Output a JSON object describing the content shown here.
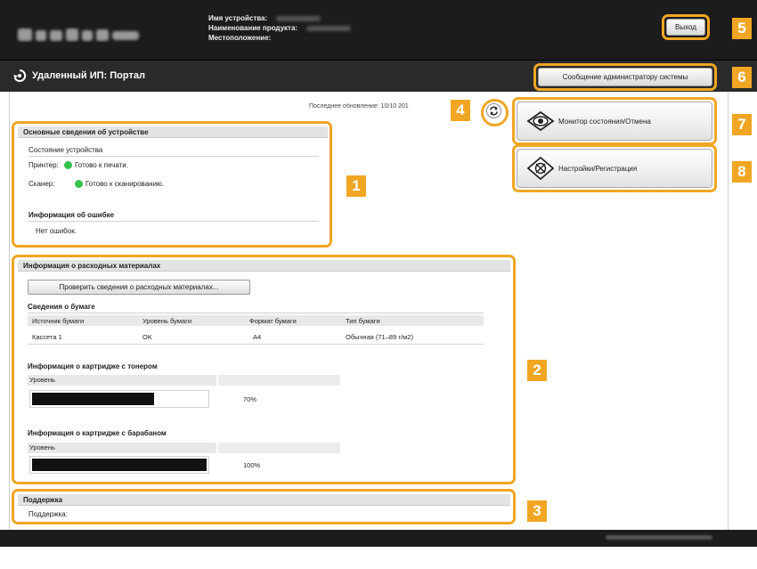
{
  "header": {
    "device_name_label": "Имя устройства:",
    "product_name_label": "Наименование продукта:",
    "location_label": "Местоположение:",
    "logout_label": "Выход"
  },
  "titlebar": {
    "title": "Удаленный ИП: Портал",
    "admin_message_label": "Сообщение администратору системы"
  },
  "last_update": "Последнее обновление: 10/10 201",
  "device_info": {
    "heading": "Основные сведения об устройстве",
    "status_title": "Состояние устройства",
    "printer_label": "Принтер:",
    "printer_status": "Готово к печати.",
    "scanner_label": "Сканер:",
    "scanner_status": "Готово к сканированию.",
    "error_title": "Информация об ошибке",
    "error_text": "Нет ошибок."
  },
  "consumables": {
    "heading": "Информация о расходных материалах",
    "check_button": "Проверить сведения о расходных материалах...",
    "paper_title": "Сведения о бумаге",
    "paper_columns": [
      "Источник бумаги",
      "Уровень бумаги",
      "Формат бумаги",
      "Тип бумаги"
    ],
    "paper_row": [
      "Кассета 1",
      "OK",
      "A4",
      "Обычная (71–89 г/м2)"
    ],
    "toner_title": "Информация о картридже с тонером",
    "toner_level_label": "Уровень",
    "toner_level_text": "70%",
    "toner_fraction": 0.7,
    "drum_title": "Информация о картридже с барабаном",
    "drum_level_label": "Уровень",
    "drum_level_text": "100%",
    "drum_fraction": 1.0
  },
  "support": {
    "heading": "Поддержка",
    "label": "Поддержка:"
  },
  "menu": {
    "status_monitor": "Монитор состояния/Отмена",
    "settings": "Настройки/Регистрация"
  },
  "callouts": [
    "1",
    "2",
    "3",
    "4",
    "5",
    "6",
    "7",
    "8"
  ],
  "colors": {
    "accent": "#f0a623",
    "ready_dot": "#34c24a",
    "header_bg": "#1c1c1c"
  }
}
